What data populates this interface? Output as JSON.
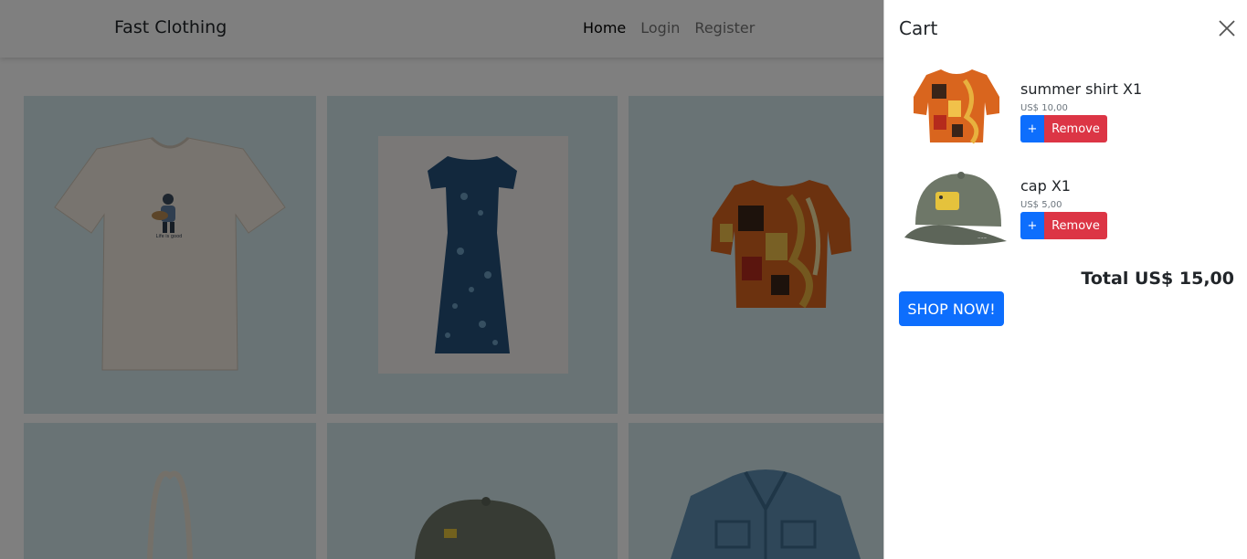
{
  "navbar": {
    "brand": "Fast Clothing",
    "links": [
      {
        "label": "Home",
        "active": true
      },
      {
        "label": "Login",
        "active": false
      },
      {
        "label": "Register",
        "active": false
      }
    ]
  },
  "products": [
    {
      "image": "t-shirt-image",
      "print_text": "Life is good"
    },
    {
      "image": "dress-image"
    },
    {
      "image": "summer-shirt-image"
    },
    {
      "image": "tote-bag-image"
    },
    {
      "image": "cap-image"
    },
    {
      "image": "denim-jacket-image"
    }
  ],
  "cart": {
    "title": "Cart",
    "close_icon": "close-icon",
    "items": [
      {
        "name": "summer shirt X1",
        "price": "US$ 10,00",
        "plus_label": "+",
        "remove_label": "Remove",
        "image": "summer-shirt-thumbnail"
      },
      {
        "name": "cap X1",
        "price": "US$ 5,00",
        "plus_label": "+",
        "remove_label": "Remove",
        "image": "cap-thumbnail"
      }
    ],
    "total": "Total US$ 15,00",
    "shop_label": "SHOP NOW!"
  },
  "colors": {
    "primary": "#0d6efd",
    "danger": "#dc3545",
    "product_bg": "#d3e7ea"
  }
}
